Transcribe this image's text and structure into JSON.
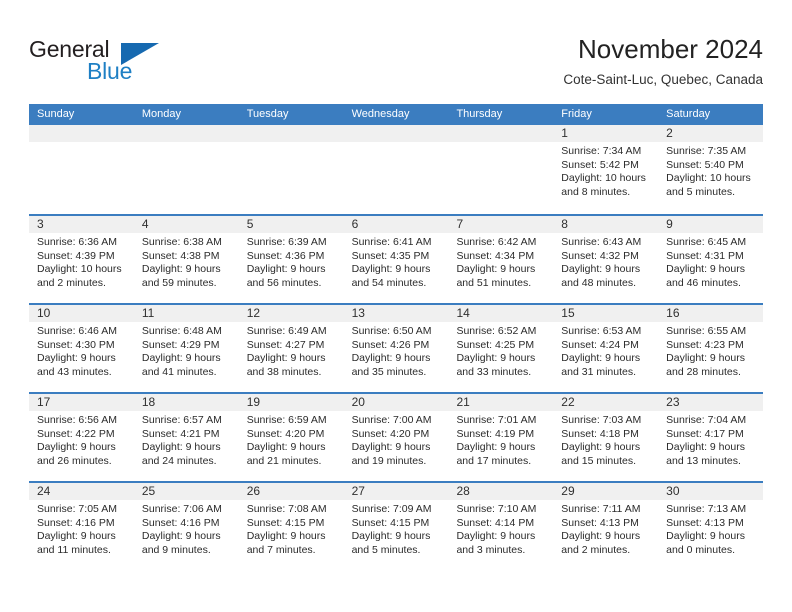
{
  "logo": {
    "word_top": "General",
    "word_bottom": "Blue",
    "triangle_color": "#1669b0",
    "blue_color": "#1e7fc4"
  },
  "header": {
    "title": "November 2024",
    "location": "Cote-Saint-Luc, Quebec, Canada"
  },
  "theme": {
    "header_bar_color": "#3b7dc0",
    "day_head_color": "#f0f0f0",
    "text_color": "#2b2b2b"
  },
  "weekdays": [
    "Sunday",
    "Monday",
    "Tuesday",
    "Wednesday",
    "Thursday",
    "Friday",
    "Saturday"
  ],
  "weeks": [
    [
      {
        "day": "",
        "empty": true
      },
      {
        "day": "",
        "empty": true
      },
      {
        "day": "",
        "empty": true
      },
      {
        "day": "",
        "empty": true
      },
      {
        "day": "",
        "empty": true
      },
      {
        "day": "1",
        "sunrise": "Sunrise: 7:34 AM",
        "sunset": "Sunset: 5:42 PM",
        "daylight1": "Daylight: 10 hours",
        "daylight2": "and 8 minutes."
      },
      {
        "day": "2",
        "sunrise": "Sunrise: 7:35 AM",
        "sunset": "Sunset: 5:40 PM",
        "daylight1": "Daylight: 10 hours",
        "daylight2": "and 5 minutes."
      }
    ],
    [
      {
        "day": "3",
        "sunrise": "Sunrise: 6:36 AM",
        "sunset": "Sunset: 4:39 PM",
        "daylight1": "Daylight: 10 hours",
        "daylight2": "and 2 minutes."
      },
      {
        "day": "4",
        "sunrise": "Sunrise: 6:38 AM",
        "sunset": "Sunset: 4:38 PM",
        "daylight1": "Daylight: 9 hours",
        "daylight2": "and 59 minutes."
      },
      {
        "day": "5",
        "sunrise": "Sunrise: 6:39 AM",
        "sunset": "Sunset: 4:36 PM",
        "daylight1": "Daylight: 9 hours",
        "daylight2": "and 56 minutes."
      },
      {
        "day": "6",
        "sunrise": "Sunrise: 6:41 AM",
        "sunset": "Sunset: 4:35 PM",
        "daylight1": "Daylight: 9 hours",
        "daylight2": "and 54 minutes."
      },
      {
        "day": "7",
        "sunrise": "Sunrise: 6:42 AM",
        "sunset": "Sunset: 4:34 PM",
        "daylight1": "Daylight: 9 hours",
        "daylight2": "and 51 minutes."
      },
      {
        "day": "8",
        "sunrise": "Sunrise: 6:43 AM",
        "sunset": "Sunset: 4:32 PM",
        "daylight1": "Daylight: 9 hours",
        "daylight2": "and 48 minutes."
      },
      {
        "day": "9",
        "sunrise": "Sunrise: 6:45 AM",
        "sunset": "Sunset: 4:31 PM",
        "daylight1": "Daylight: 9 hours",
        "daylight2": "and 46 minutes."
      }
    ],
    [
      {
        "day": "10",
        "sunrise": "Sunrise: 6:46 AM",
        "sunset": "Sunset: 4:30 PM",
        "daylight1": "Daylight: 9 hours",
        "daylight2": "and 43 minutes."
      },
      {
        "day": "11",
        "sunrise": "Sunrise: 6:48 AM",
        "sunset": "Sunset: 4:29 PM",
        "daylight1": "Daylight: 9 hours",
        "daylight2": "and 41 minutes."
      },
      {
        "day": "12",
        "sunrise": "Sunrise: 6:49 AM",
        "sunset": "Sunset: 4:27 PM",
        "daylight1": "Daylight: 9 hours",
        "daylight2": "and 38 minutes."
      },
      {
        "day": "13",
        "sunrise": "Sunrise: 6:50 AM",
        "sunset": "Sunset: 4:26 PM",
        "daylight1": "Daylight: 9 hours",
        "daylight2": "and 35 minutes."
      },
      {
        "day": "14",
        "sunrise": "Sunrise: 6:52 AM",
        "sunset": "Sunset: 4:25 PM",
        "daylight1": "Daylight: 9 hours",
        "daylight2": "and 33 minutes."
      },
      {
        "day": "15",
        "sunrise": "Sunrise: 6:53 AM",
        "sunset": "Sunset: 4:24 PM",
        "daylight1": "Daylight: 9 hours",
        "daylight2": "and 31 minutes."
      },
      {
        "day": "16",
        "sunrise": "Sunrise: 6:55 AM",
        "sunset": "Sunset: 4:23 PM",
        "daylight1": "Daylight: 9 hours",
        "daylight2": "and 28 minutes."
      }
    ],
    [
      {
        "day": "17",
        "sunrise": "Sunrise: 6:56 AM",
        "sunset": "Sunset: 4:22 PM",
        "daylight1": "Daylight: 9 hours",
        "daylight2": "and 26 minutes."
      },
      {
        "day": "18",
        "sunrise": "Sunrise: 6:57 AM",
        "sunset": "Sunset: 4:21 PM",
        "daylight1": "Daylight: 9 hours",
        "daylight2": "and 24 minutes."
      },
      {
        "day": "19",
        "sunrise": "Sunrise: 6:59 AM",
        "sunset": "Sunset: 4:20 PM",
        "daylight1": "Daylight: 9 hours",
        "daylight2": "and 21 minutes."
      },
      {
        "day": "20",
        "sunrise": "Sunrise: 7:00 AM",
        "sunset": "Sunset: 4:20 PM",
        "daylight1": "Daylight: 9 hours",
        "daylight2": "and 19 minutes."
      },
      {
        "day": "21",
        "sunrise": "Sunrise: 7:01 AM",
        "sunset": "Sunset: 4:19 PM",
        "daylight1": "Daylight: 9 hours",
        "daylight2": "and 17 minutes."
      },
      {
        "day": "22",
        "sunrise": "Sunrise: 7:03 AM",
        "sunset": "Sunset: 4:18 PM",
        "daylight1": "Daylight: 9 hours",
        "daylight2": "and 15 minutes."
      },
      {
        "day": "23",
        "sunrise": "Sunrise: 7:04 AM",
        "sunset": "Sunset: 4:17 PM",
        "daylight1": "Daylight: 9 hours",
        "daylight2": "and 13 minutes."
      }
    ],
    [
      {
        "day": "24",
        "sunrise": "Sunrise: 7:05 AM",
        "sunset": "Sunset: 4:16 PM",
        "daylight1": "Daylight: 9 hours",
        "daylight2": "and 11 minutes."
      },
      {
        "day": "25",
        "sunrise": "Sunrise: 7:06 AM",
        "sunset": "Sunset: 4:16 PM",
        "daylight1": "Daylight: 9 hours",
        "daylight2": "and 9 minutes."
      },
      {
        "day": "26",
        "sunrise": "Sunrise: 7:08 AM",
        "sunset": "Sunset: 4:15 PM",
        "daylight1": "Daylight: 9 hours",
        "daylight2": "and 7 minutes."
      },
      {
        "day": "27",
        "sunrise": "Sunrise: 7:09 AM",
        "sunset": "Sunset: 4:15 PM",
        "daylight1": "Daylight: 9 hours",
        "daylight2": "and 5 minutes."
      },
      {
        "day": "28",
        "sunrise": "Sunrise: 7:10 AM",
        "sunset": "Sunset: 4:14 PM",
        "daylight1": "Daylight: 9 hours",
        "daylight2": "and 3 minutes."
      },
      {
        "day": "29",
        "sunrise": "Sunrise: 7:11 AM",
        "sunset": "Sunset: 4:13 PM",
        "daylight1": "Daylight: 9 hours",
        "daylight2": "and 2 minutes."
      },
      {
        "day": "30",
        "sunrise": "Sunrise: 7:13 AM",
        "sunset": "Sunset: 4:13 PM",
        "daylight1": "Daylight: 9 hours",
        "daylight2": "and 0 minutes."
      }
    ]
  ]
}
